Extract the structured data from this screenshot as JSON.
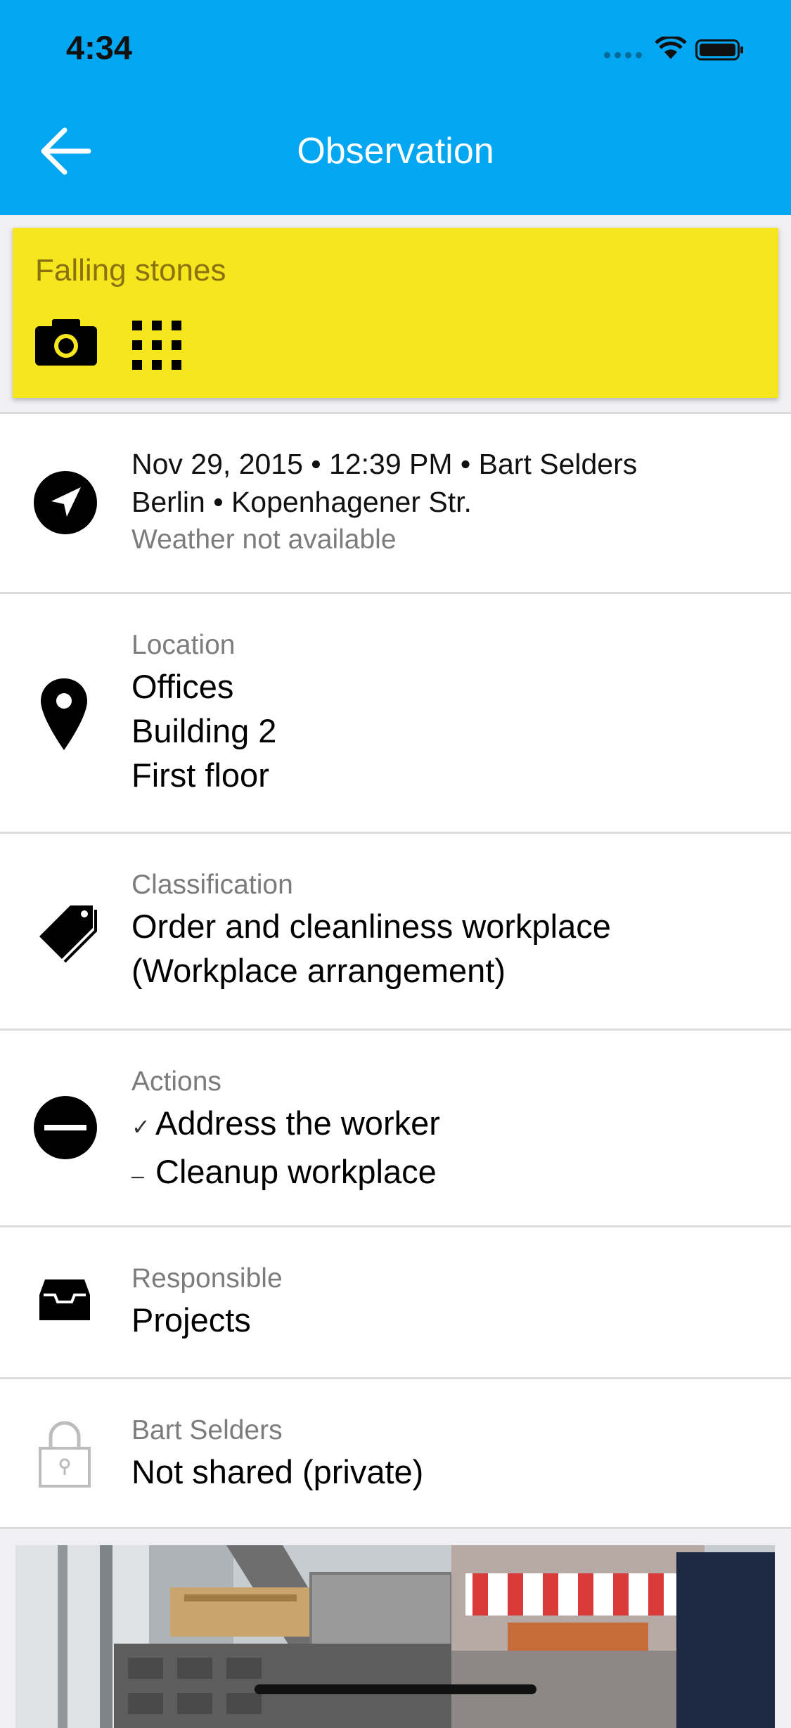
{
  "status_bar": {
    "time": "4:34"
  },
  "nav": {
    "title": "Observation",
    "back_icon": "arrow-left-icon"
  },
  "observation": {
    "title": "Falling stones",
    "color": "#f6e61d",
    "tools": [
      "camera-icon",
      "grid-icon"
    ]
  },
  "meta": {
    "line1": "Nov 29, 2015 • 12:39 PM • Bart Selders",
    "line2": "Berlin • Kopenhagener Str.",
    "weather": "Weather not available"
  },
  "location": {
    "label": "Location",
    "lines": [
      "Offices",
      "Building 2",
      "First floor"
    ]
  },
  "classification": {
    "label": "Classification",
    "lines": [
      "Order and cleanliness workplace",
      "(Workplace arrangement)"
    ]
  },
  "actions": {
    "label": "Actions",
    "items": [
      {
        "mark": "✓",
        "text": "Address the worker"
      },
      {
        "mark": "–",
        "text": "Cleanup workplace"
      }
    ]
  },
  "responsible": {
    "label": "Responsible",
    "value": "Projects"
  },
  "sharing": {
    "label": "Bart Selders",
    "value": "Not shared (private)"
  },
  "colors": {
    "header": "#03a6f0",
    "card": "#f6e61d"
  }
}
